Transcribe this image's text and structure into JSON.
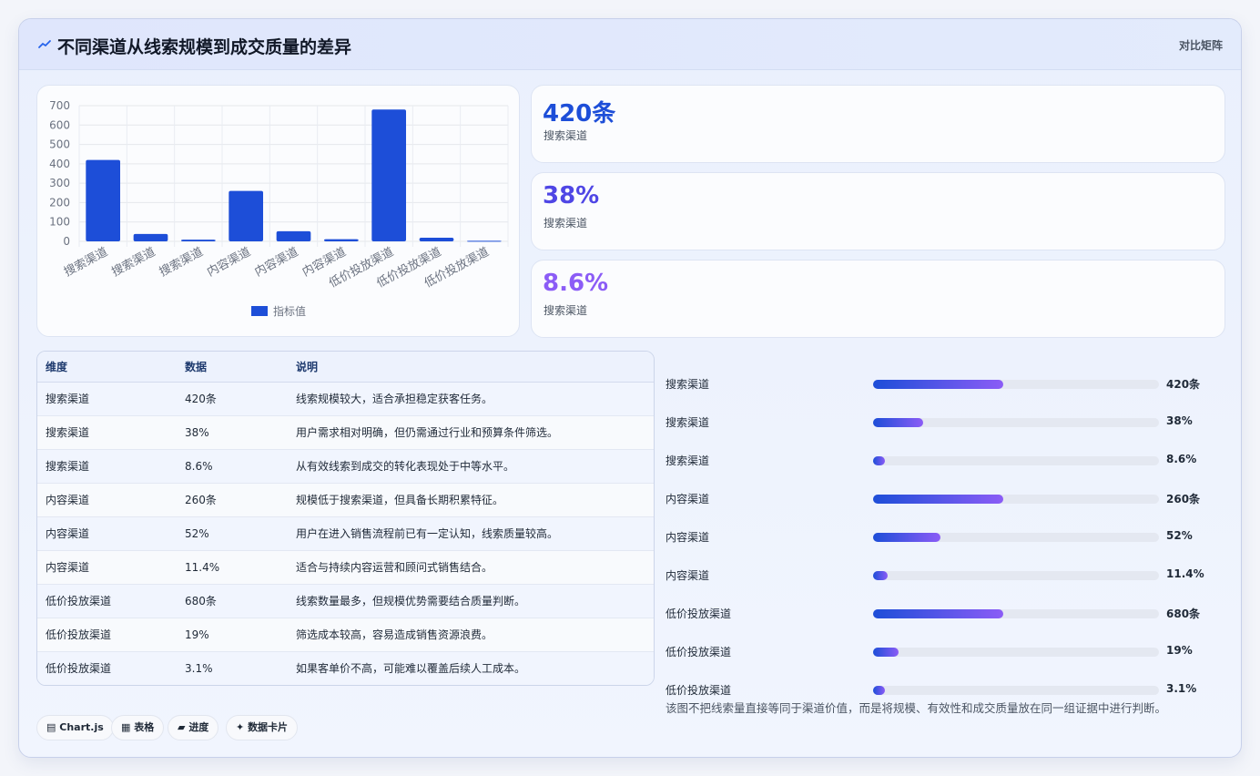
{
  "header": {
    "title": "不同渠道从线索规模到成交质量的差异",
    "subtitle": "对比矩阵"
  },
  "chart_data": {
    "type": "bar",
    "categories": [
      "搜索渠道",
      "搜索渠道",
      "搜索渠道",
      "内容渠道",
      "内容渠道",
      "内容渠道",
      "低价投放渠道",
      "低价投放渠道",
      "低价投放渠道"
    ],
    "series": [
      {
        "name": "指标值",
        "values": [
          420,
          38,
          8.6,
          260,
          52,
          11.4,
          680,
          19,
          3.1
        ]
      }
    ],
    "yticks": [
      0,
      100,
      200,
      300,
      400,
      500,
      600,
      700
    ],
    "ylim": [
      0,
      700
    ],
    "grid": true,
    "legend": "bottom",
    "bar_color": "#1d4ed8"
  },
  "stats": [
    {
      "value": "420条",
      "label": "搜索渠道",
      "color": "#1d4ed8"
    },
    {
      "value": "38%",
      "label": "搜索渠道",
      "color": "#4f46e5"
    },
    {
      "value": "8.6%",
      "label": "搜索渠道",
      "color": "#8b5cf6"
    }
  ],
  "table": {
    "headers": [
      "维度",
      "数据",
      "说明"
    ],
    "rows": [
      [
        "搜索渠道",
        "420条",
        "线索规模较大，适合承担稳定获客任务。"
      ],
      [
        "搜索渠道",
        "38%",
        "用户需求相对明确，但仍需通过行业和预算条件筛选。"
      ],
      [
        "搜索渠道",
        "8.6%",
        "从有效线索到成交的转化表现处于中等水平。"
      ],
      [
        "内容渠道",
        "260条",
        "规模低于搜索渠道，但具备长期积累特征。"
      ],
      [
        "内容渠道",
        "52%",
        "用户在进入销售流程前已有一定认知，线索质量较高。"
      ],
      [
        "内容渠道",
        "11.4%",
        "适合与持续内容运营和顾问式销售结合。"
      ],
      [
        "低价投放渠道",
        "680条",
        "线索数量最多，但规模优势需要结合质量判断。"
      ],
      [
        "低价投放渠道",
        "19%",
        "筛选成本较高，容易造成销售资源浪费。"
      ],
      [
        "低价投放渠道",
        "3.1%",
        "如果客单价不高，可能难以覆盖后续人工成本。"
      ]
    ]
  },
  "progress": [
    {
      "label": "搜索渠道",
      "value": "420条",
      "fill": 0.455
    },
    {
      "label": "搜索渠道",
      "value": "38%",
      "fill": 0.175
    },
    {
      "label": "搜索渠道",
      "value": "8.6%",
      "fill": 0.04
    },
    {
      "label": "内容渠道",
      "value": "260条",
      "fill": 0.455
    },
    {
      "label": "内容渠道",
      "value": "52%",
      "fill": 0.235
    },
    {
      "label": "内容渠道",
      "value": "11.4%",
      "fill": 0.05
    },
    {
      "label": "低价投放渠道",
      "value": "680条",
      "fill": 0.455
    },
    {
      "label": "低价投放渠道",
      "value": "19%",
      "fill": 0.09
    },
    {
      "label": "低价投放渠道",
      "value": "3.1%",
      "fill": 0.04
    }
  ],
  "note": "该图不把线索量直接等同于渠道价值，而是将规模、有效性和成交质量放在同一组证据中进行判断。",
  "tags": [
    {
      "icon": "chart-icon",
      "label": "Chart.js"
    },
    {
      "icon": "table-icon",
      "label": "表格"
    },
    {
      "icon": "progress-icon",
      "label": "进度"
    },
    {
      "icon": "sparkle-icon",
      "label": "数据卡片"
    }
  ]
}
